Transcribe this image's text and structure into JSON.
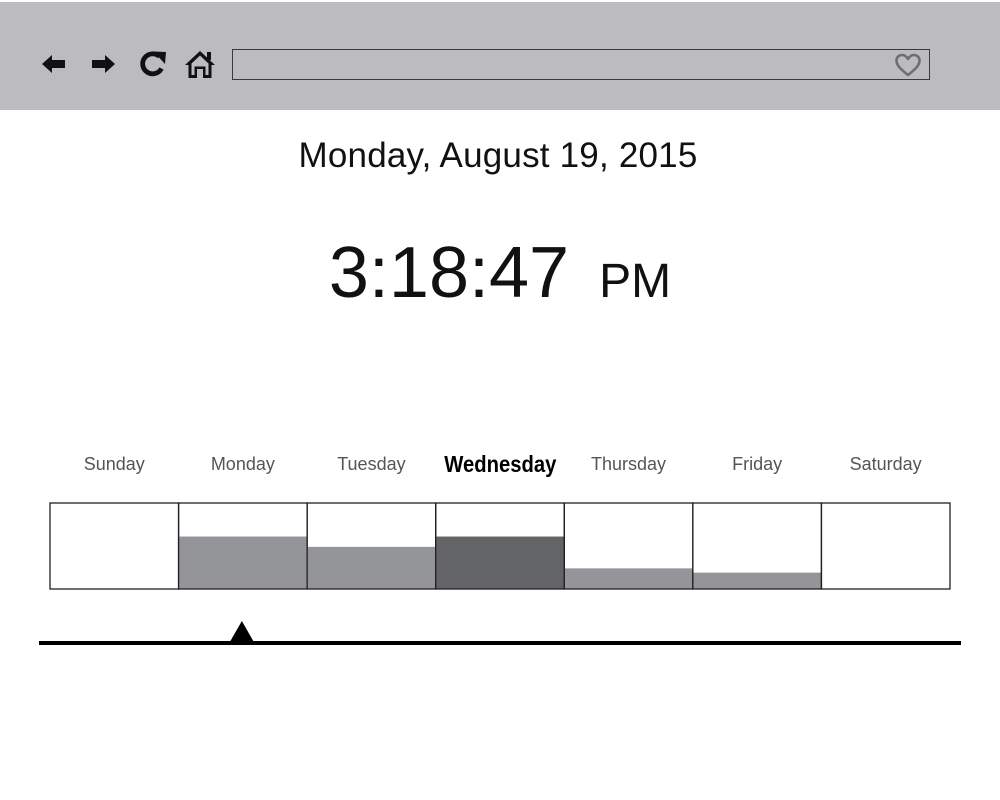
{
  "browser": {
    "url_value": "",
    "icons": {
      "back": "back-arrow-icon",
      "forward": "forward-arrow-icon",
      "reload": "reload-icon",
      "home": "home-icon",
      "favorite": "heart-icon"
    }
  },
  "header": {
    "date": "Monday, August 19, 2015"
  },
  "clock": {
    "time": "3:18:47",
    "period": "PM"
  },
  "week": {
    "days": [
      "Sunday",
      "Monday",
      "Tuesday",
      "Wednesday",
      "Thursday",
      "Friday",
      "Saturday"
    ],
    "current_day": "Wednesday"
  },
  "chart_data": {
    "type": "bar",
    "categories": [
      "Sunday",
      "Monday",
      "Tuesday",
      "Wednesday",
      "Thursday",
      "Friday",
      "Saturday"
    ],
    "values": [
      0,
      0.61,
      0.49,
      0.61,
      0.24,
      0.19,
      0
    ],
    "ylim": [
      0,
      1
    ],
    "highlight": "Wednesday",
    "colors": {
      "bar": "#939598",
      "highlight": "#636466",
      "border": "#231f20"
    }
  },
  "timeline": {
    "marker_position": 0.22
  }
}
